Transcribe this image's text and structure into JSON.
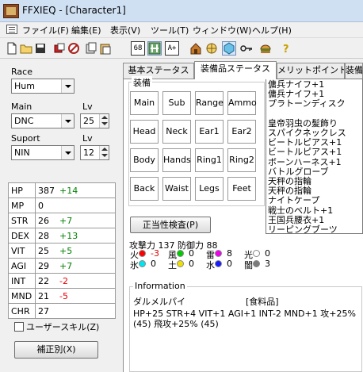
{
  "window": {
    "title": "FFXIEQ - [Character1]"
  },
  "menu": [
    "ファイル(F)",
    "編集(E)",
    "表示(V)",
    "ツール(T)",
    "ウィンドウ(W)",
    "ヘルプ(H)"
  ],
  "toolbar": {
    "box1": "68",
    "box2": "A+"
  },
  "left": {
    "race_label": "Race",
    "race_value": "Hum",
    "main_label": "Main",
    "main_value": "DNC",
    "main_lv_label": "Lv",
    "main_lv_value": "25",
    "support_label": "Suport",
    "support_value": "NIN",
    "support_lv_label": "Lv",
    "support_lv_value": "12",
    "stats": [
      {
        "name": "HP",
        "value": "387",
        "bonus": "+14",
        "bonus_color": "#008000"
      },
      {
        "name": "MP",
        "value": "0",
        "bonus": "",
        "bonus_color": "#008000"
      },
      {
        "name": "STR",
        "value": "26",
        "bonus": "+7",
        "bonus_color": "#008000"
      },
      {
        "name": "DEX",
        "value": "28",
        "bonus": "+13",
        "bonus_color": "#008000"
      },
      {
        "name": "VIT",
        "value": "25",
        "bonus": "+5",
        "bonus_color": "#008000"
      },
      {
        "name": "AGI",
        "value": "29",
        "bonus": "+7",
        "bonus_color": "#008000"
      },
      {
        "name": "INT",
        "value": "22",
        "bonus": "-2",
        "bonus_color": "#e00000"
      },
      {
        "name": "MND",
        "value": "21",
        "bonus": "-5",
        "bonus_color": "#e00000"
      },
      {
        "name": "CHR",
        "value": "27",
        "bonus": "",
        "bonus_color": "#008000"
      }
    ],
    "user_skill_label": "ユーザースキル(Z)",
    "adjust_button": "補正別(X)"
  },
  "tabs": [
    "基本ステータス",
    "装備品ステータス",
    "メリットポイント",
    "装備"
  ],
  "equipment": {
    "legend": "装備",
    "slots": [
      "Main",
      "Sub",
      "Range",
      "Ammo",
      "Head",
      "Neck",
      "Ear1",
      "Ear2",
      "Body",
      "Hands",
      "Ring1",
      "Ring2",
      "Back",
      "Waist",
      "Legs",
      "Feet"
    ]
  },
  "item_list": [
    "傭兵ナイフ+1",
    "傭兵ナイフ+1",
    "プラトーンディスク",
    "",
    "皇帝羽虫の髪飾り",
    "スパイクネックレス",
    "ビートルピアス+1",
    "ビートルピアス+1",
    "ボーンハーネス+1",
    "バトルグローブ",
    "天秤の指輪",
    "天秤の指輪",
    "ナイトケープ",
    "戦士のベルト+1",
    "王国兵腰衣+1",
    "リーピングブーツ"
  ],
  "validity_button": "正当性検査(P)",
  "attack_defense": "攻撃力 137 防御力  88",
  "elements": [
    {
      "name": "火",
      "value": "-3",
      "color": "#ff0000",
      "value_color": "#e00000"
    },
    {
      "name": "風",
      "value": "0",
      "color": "#00cc00",
      "value_color": "#000000"
    },
    {
      "name": "雷",
      "value": "8",
      "color": "#ee00ee",
      "value_color": "#000000"
    },
    {
      "name": "光",
      "value": "0",
      "color": "#ffffff",
      "value_color": "#000000"
    },
    {
      "name": "氷",
      "value": "0",
      "color": "#00e5ee",
      "value_color": "#000000"
    },
    {
      "name": "土",
      "value": "0",
      "color": "#f0e000",
      "value_color": "#000000"
    },
    {
      "name": "水",
      "value": "0",
      "color": "#1a1aff",
      "value_color": "#000000"
    },
    {
      "name": "闇",
      "value": "3",
      "color": "#7a7a7a",
      "value_color": "#000000"
    }
  ],
  "information": {
    "legend": "Information",
    "item_name": "ダルメルパイ",
    "item_type": "[食料品]",
    "line1": "HP+25 STR+4 VIT+1 AGI+1 INT-2 MND+1 攻+25%",
    "line2": "(45) 飛攻+25% (45)"
  }
}
